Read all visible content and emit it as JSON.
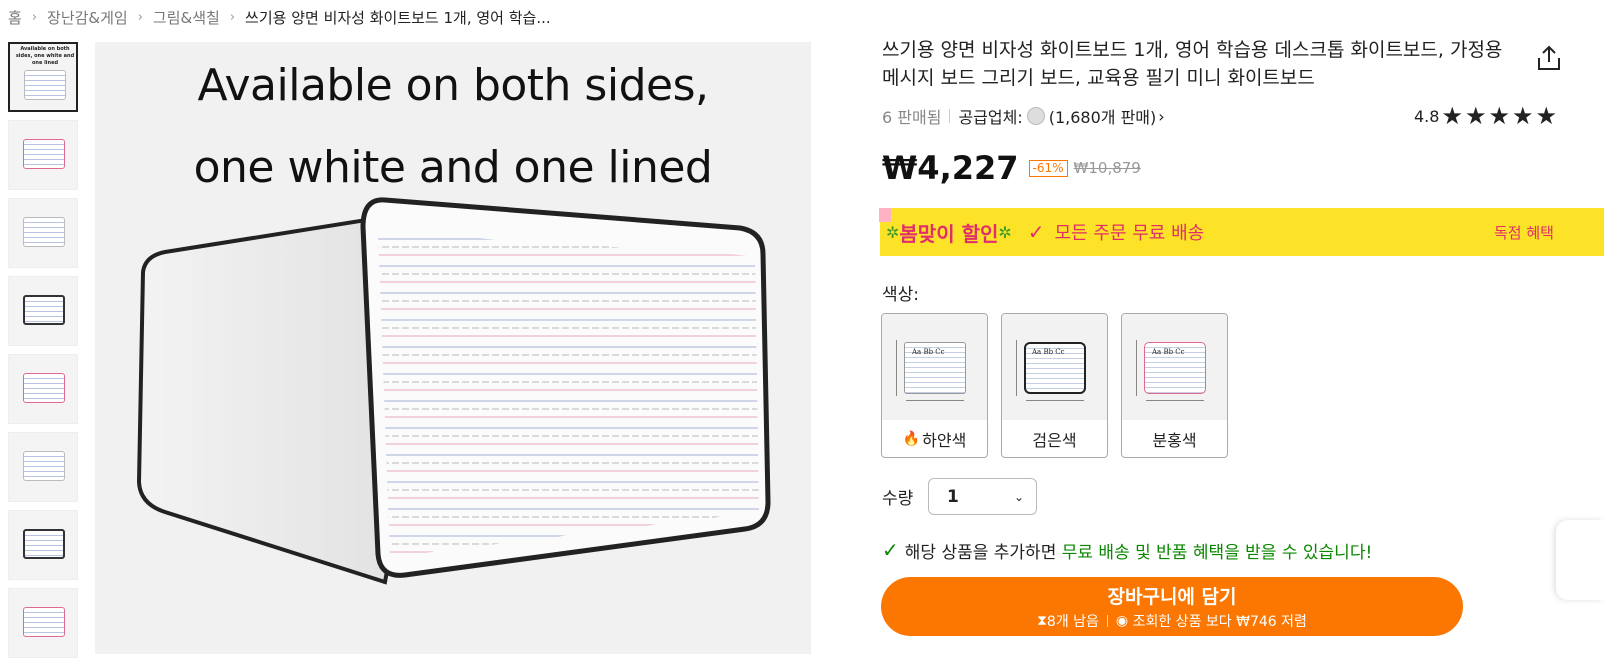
{
  "breadcrumb": {
    "home": "홈",
    "cat1": "장난감&게임",
    "cat2": "그림&색칠",
    "current": "쓰기용 양면 비자성 화이트보드 1개, 영어 학습..."
  },
  "thumbnail_caption": "Available on both sides, one white and one lined",
  "main_image": {
    "caption_line1": "Available on both sides,",
    "caption_line2": "one white and one lined"
  },
  "product": {
    "title": "쓰기용 양면 비자성 화이트보드 1개, 영어 학습용 데스크톱 화이트보드, 가정용 메시지 보드 그리기 보드, 교육용 필기 미니 화이트보드",
    "sold": "6 판매됨",
    "supplier_label": "공급업체:",
    "supplier_sales": "(1,680개 판매)",
    "rating": "4.8",
    "stars": "★★★★★",
    "price": "₩4,227",
    "discount": "-61%",
    "original_price": "₩10,879"
  },
  "promo": {
    "badge": "봄맞이 할인",
    "text": "모든 주문 무료 배송",
    "exclusive": "독점 혜택",
    "bg_color": "#fde327",
    "accent_color": "#e02d6c"
  },
  "color_option": {
    "label": "색상:",
    "options": [
      {
        "name": "하얀색",
        "hot": true
      },
      {
        "name": "검은색",
        "hot": false
      },
      {
        "name": "분홍색",
        "hot": false
      }
    ],
    "swatch_text": "Aa Bb Cc"
  },
  "quantity": {
    "label": "수량",
    "value": "1"
  },
  "benefit": {
    "prefix": "해당 상품을 추가하면",
    "highlight": "무료 배송 및 반품 혜택을 받을 수 있습니다!"
  },
  "cart_button": {
    "label": "장바구니에 담기",
    "stock": "8개 남음",
    "compare": "조회한 상품 보다 ₩746 저렴",
    "color": "#fb7701"
  }
}
